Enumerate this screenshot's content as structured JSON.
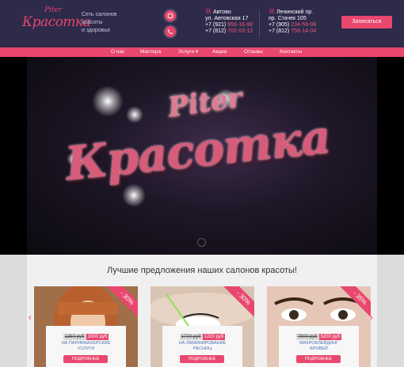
{
  "header": {
    "logo_top": "Piter",
    "logo_name": "Красотка",
    "tagline": [
      "Сеть салонов",
      "красоты",
      "и здоровья"
    ],
    "locations": [
      {
        "name": "Автово",
        "street": "ул. Автовская 17",
        "phone1_prefix": "+7 (921)",
        "phone1": "956-16-98",
        "phone2_prefix": "+7 (812)",
        "phone2": "702-03-12"
      },
      {
        "name": "Ленинский пр.",
        "street": "пр. Стачек 105",
        "phone1_prefix": "+7 (905)",
        "phone1": "234-59-98",
        "phone2_prefix": "+7 (812)",
        "phone2": "758-14-04"
      }
    ],
    "cta_label": "Записаться"
  },
  "nav": {
    "items": [
      "О нас",
      "Мастера",
      "Услуги",
      "Акции",
      "Отзывы",
      "Контакты"
    ]
  },
  "video": {
    "title_top": "Piter",
    "title_main": "Красотка"
  },
  "offers": {
    "title": "Лучшие предложения наших салонов красоты!",
    "cards": [
      {
        "discount": "- 30%",
        "old_price": "1350 руб",
        "new_price": "1000 руб",
        "name_line1": "НА ПАРИКМАХЕРСКИЕ",
        "name_line2": "УСЛУГИ",
        "button": "ПОДРОБНЕЕ"
      },
      {
        "discount": "- 30%",
        "old_price": "1700 руб",
        "new_price": "1220 руб",
        "name_line1": "НА ЛАМИНИРОВАНИЕ",
        "name_line2": "РЕСНИЦ",
        "button": "ПОДРОБНЕЕ"
      },
      {
        "discount": "- 35%",
        "old_price": "7800 руб",
        "new_price": "5200 руб",
        "name_line1": "МИКРОБЛЕЙДИНГ",
        "name_line2": "БРОВЕЙ",
        "button": "ПОДРОБНЕЕ"
      }
    ]
  },
  "colors": {
    "accent": "#e9476e",
    "header_bg": "#2d2a4a"
  },
  "icons": {
    "phone": "viber-icon",
    "phone2": "phone-icon",
    "arrows": "chevron-icon"
  }
}
